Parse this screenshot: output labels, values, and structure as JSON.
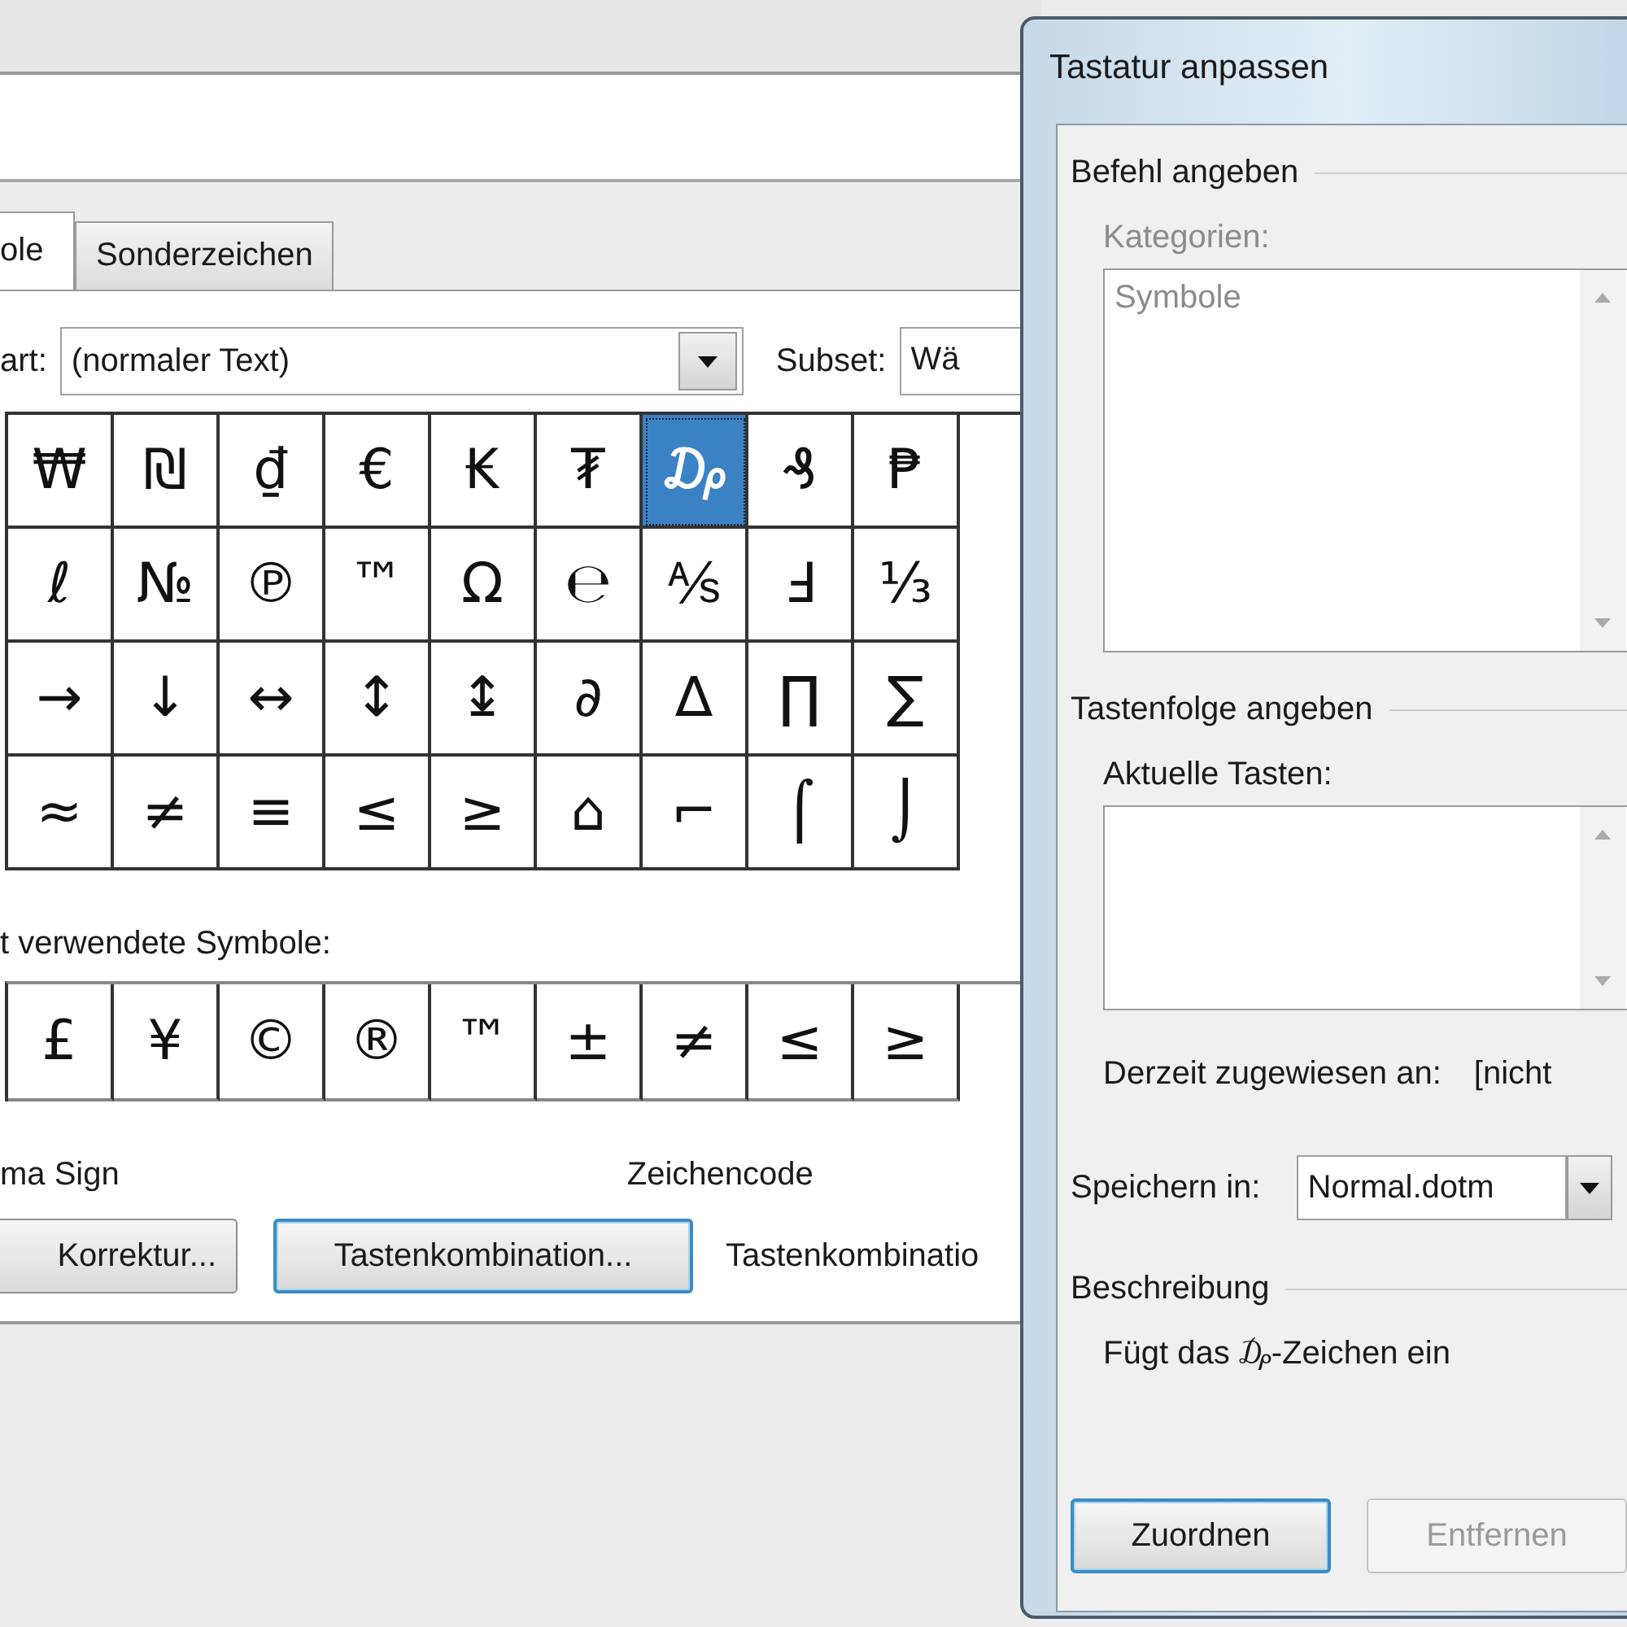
{
  "symbol_dialog": {
    "tabs": [
      {
        "label": "ole",
        "selected": true
      },
      {
        "label": "Sonderzeichen",
        "selected": false
      }
    ],
    "font_label": "art:",
    "font_value": "(normaler Text)",
    "subset_label": "Subset:",
    "subset_value": "Wä",
    "symbols": [
      [
        {
          "char": "₩",
          "selected": false
        },
        {
          "char": "₪",
          "selected": false
        },
        {
          "char": "₫",
          "selected": false
        },
        {
          "char": "€",
          "selected": false
        },
        {
          "char": "₭",
          "selected": false
        },
        {
          "char": "₮",
          "selected": false
        },
        {
          "char": "₯",
          "selected": true
        },
        {
          "char": "₰",
          "selected": false
        },
        {
          "char": "₱",
          "selected": false
        }
      ],
      [
        {
          "char": "ℓ",
          "selected": false
        },
        {
          "char": "№",
          "selected": false
        },
        {
          "char": "℗",
          "selected": false
        },
        {
          "char": "™",
          "selected": false
        },
        {
          "char": "Ω",
          "selected": false
        },
        {
          "char": "℮",
          "selected": false
        },
        {
          "char": "⅍",
          "selected": false
        },
        {
          "char": "Ⅎ",
          "selected": false
        },
        {
          "char": "⅓",
          "selected": false
        }
      ],
      [
        {
          "char": "→",
          "selected": false
        },
        {
          "char": "↓",
          "selected": false
        },
        {
          "char": "↔",
          "selected": false
        },
        {
          "char": "↕",
          "selected": false
        },
        {
          "char": "↨",
          "selected": false
        },
        {
          "char": "∂",
          "selected": false
        },
        {
          "char": "∆",
          "selected": false
        },
        {
          "char": "∏",
          "selected": false
        },
        {
          "char": "∑",
          "selected": false
        }
      ],
      [
        {
          "char": "≈",
          "selected": false
        },
        {
          "char": "≠",
          "selected": false
        },
        {
          "char": "≡",
          "selected": false
        },
        {
          "char": "≤",
          "selected": false
        },
        {
          "char": "≥",
          "selected": false
        },
        {
          "char": "⌂",
          "selected": false
        },
        {
          "char": "⌐",
          "selected": false
        },
        {
          "char": "⌠",
          "selected": false
        },
        {
          "char": "⌡",
          "selected": false
        }
      ]
    ],
    "recent_label": "t verwendete Symbole:",
    "recent": [
      "£",
      "¥",
      "©",
      "®",
      "™",
      "±",
      "≠",
      "≤",
      "≥"
    ],
    "symbol_name": "ma Sign",
    "char_code_label": "Zeichencode",
    "buttons": [
      {
        "label": "Korrektur...",
        "focused": false
      },
      {
        "label": "Tastenkombination...",
        "focused": true
      }
    ],
    "shortcut_label": "Tastenkombinatio"
  },
  "keyboard_dialog": {
    "title": "Tastatur anpassen",
    "command_group": "Befehl angeben",
    "categories_label": "Kategorien:",
    "categories_disabled": true,
    "categories": [
      "Symbole"
    ],
    "keys_group": "Tastenfolge angeben",
    "current_keys_label": "Aktuelle Tasten:",
    "assigned_label": "Derzeit zugewiesen an:",
    "assigned_value": "[nicht",
    "save_label": "Speichern in:",
    "save_value": "Normal.dotm",
    "description_group": "Beschreibung",
    "description": "Fügt das ₯-Zeichen ein",
    "buttons": [
      {
        "label": "Zuordnen",
        "focused": true,
        "disabled": false
      },
      {
        "label": "Entfernen",
        "focused": false,
        "disabled": true
      }
    ]
  }
}
